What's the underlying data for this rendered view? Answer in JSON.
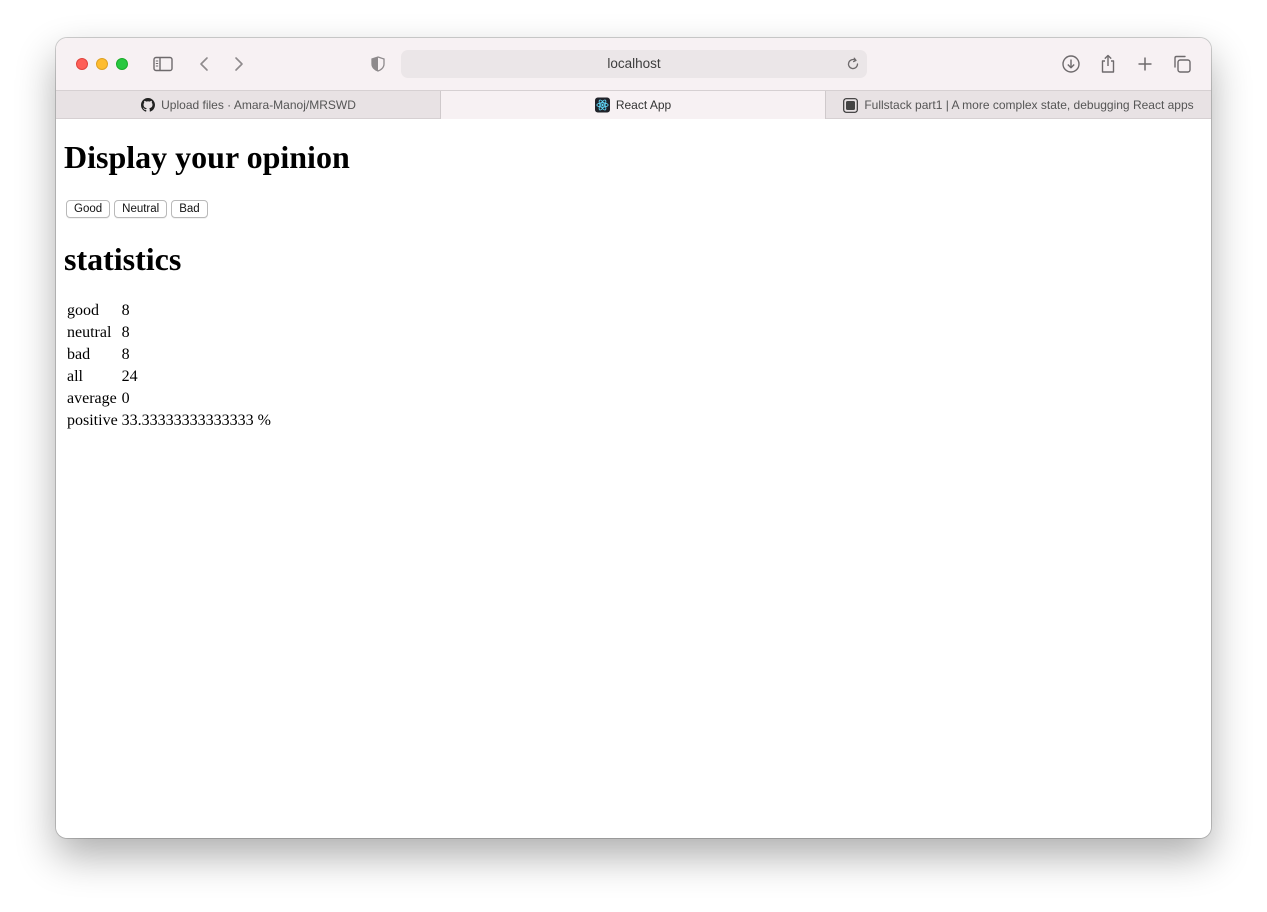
{
  "browser": {
    "url": "localhost",
    "tabs": [
      {
        "label": "Upload files · Amara-Manoj/MRSWD",
        "icon": "github-icon"
      },
      {
        "label": "React App",
        "icon": "react-icon",
        "active": true
      },
      {
        "label": "Fullstack part1 | A more complex state, debugging React apps",
        "icon": "fullstack-icon"
      }
    ]
  },
  "page": {
    "heading": "Display your opinion",
    "buttons": {
      "good": "Good",
      "neutral": "Neutral",
      "bad": "Bad"
    },
    "stats_heading": "statistics",
    "stats": [
      {
        "label": "good",
        "value": "8"
      },
      {
        "label": "neutral",
        "value": "8"
      },
      {
        "label": "bad",
        "value": "8"
      },
      {
        "label": "all",
        "value": "24"
      },
      {
        "label": "average",
        "value": "0"
      },
      {
        "label": "positive",
        "value": "33.33333333333333 %"
      }
    ]
  }
}
